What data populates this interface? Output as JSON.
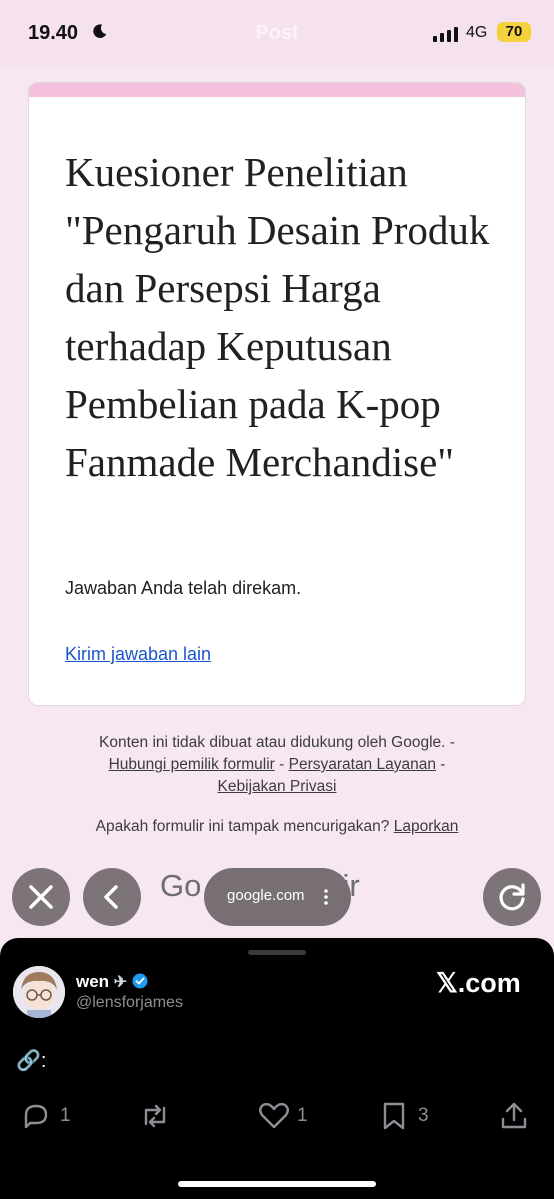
{
  "status_bar": {
    "time": "19.40",
    "ghost_title": "Post",
    "network": "4G",
    "battery": "70"
  },
  "form": {
    "title": "Kuesioner Penelitian \"Pengaruh Desain Produk dan Persepsi Harga terhadap Keputusan Pembelian pada K-pop Fanmade Merchandise\"",
    "message": "Jawaban Anda telah direkam.",
    "link": "Kirim jawaban lain"
  },
  "footer": {
    "disclaimer": "Konten ini tidak dibuat atau didukung oleh Google. -",
    "contact_link": "Hubungi pemilik formulir",
    "sep1": " - ",
    "terms_link": "Persyaratan Layanan",
    "sep2": " -",
    "privacy_link": "Kebijakan Privasi",
    "report_prompt": "Apakah formulir ini tampak mencurigakan?",
    "report_link": "Laporkan"
  },
  "browser": {
    "brand_left": "Go",
    "brand_right": "ulir",
    "url": "google.com",
    "icons": [
      "close-icon",
      "back-icon",
      "more-icon",
      "reload-icon"
    ]
  },
  "tweet": {
    "username": "wen",
    "handle": "@lensforjames",
    "source": "𝕏.com",
    "text": "🔗:",
    "reply_count": "1",
    "like_count": "1",
    "bookmark_count": "3",
    "colors": {
      "verified": "#1d9bf0",
      "muted": "#8b8f94",
      "link": "#1a56c8",
      "accent": "#f3c1dc"
    }
  }
}
